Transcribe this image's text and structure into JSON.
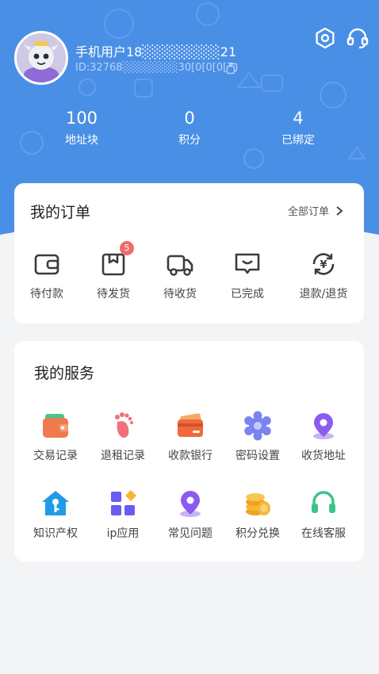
{
  "profile": {
    "username": "手机用户18░░░░░░░░21",
    "user_id": "ID:32768░░░░░░░30[0[0[0[7",
    "avatar_icon": "cartoon-avatar-icon",
    "accent_color": "#4a8fe6"
  },
  "header_icons": [
    "settings-icon",
    "headset-icon"
  ],
  "stats": [
    {
      "value": "100",
      "label": "地址块"
    },
    {
      "value": "0",
      "label": "积分"
    },
    {
      "value": "4",
      "label": "已绑定"
    }
  ],
  "orders": {
    "title": "我的订单",
    "all_label": "全部订单",
    "items": [
      {
        "label": "待付款",
        "icon": "wallet-icon"
      },
      {
        "label": "待发货",
        "icon": "package-icon",
        "badge": "5"
      },
      {
        "label": "待收货",
        "icon": "truck-icon"
      },
      {
        "label": "已完成",
        "icon": "message-check-icon"
      },
      {
        "label": "退款/退货",
        "icon": "refund-icon"
      }
    ]
  },
  "services": {
    "title": "我的服务",
    "items": [
      {
        "label": "交易记录",
        "icon": "wallet-icon"
      },
      {
        "label": "退租记录",
        "icon": "footprint-icon"
      },
      {
        "label": "收款银行",
        "icon": "bank-card-icon"
      },
      {
        "label": "密码设置",
        "icon": "gear-icon"
      },
      {
        "label": "收货地址",
        "icon": "location-pin-icon"
      },
      {
        "label": "知识产权",
        "icon": "house-key-icon"
      },
      {
        "label": "ip应用",
        "icon": "apps-grid-icon"
      },
      {
        "label": "常见问题",
        "icon": "location-pin-icon"
      },
      {
        "label": "积分兑换",
        "icon": "coins-icon"
      },
      {
        "label": "在线客服",
        "icon": "headset-icon"
      }
    ]
  }
}
